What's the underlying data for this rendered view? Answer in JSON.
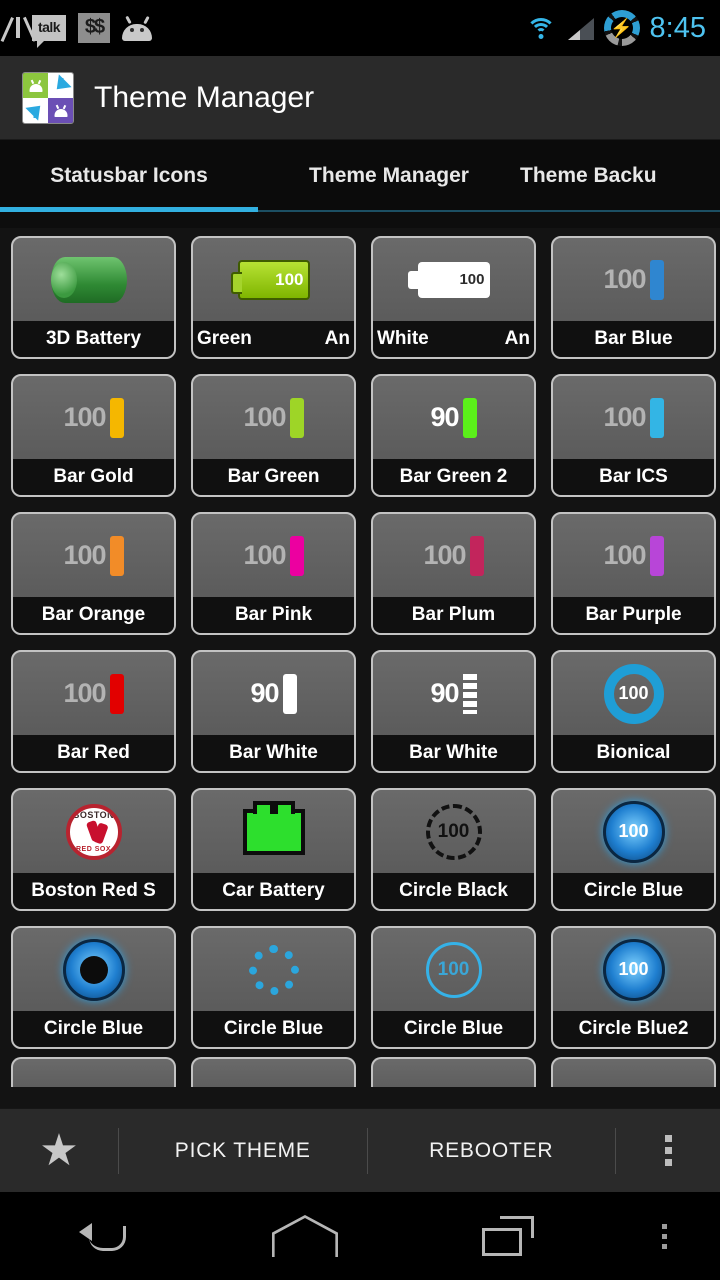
{
  "statusbar": {
    "icons_left": [
      "gmail-icon",
      "talk-icon",
      "currency-icon",
      "android-icon"
    ],
    "icons_right": [
      "wifi-icon",
      "signal-icon",
      "battery-icon"
    ],
    "clock": "8:45",
    "clock_color": "#4ec3f0"
  },
  "actionbar": {
    "app_icon": "theme-manager-app-icon",
    "title": "Theme Manager"
  },
  "tabs": [
    {
      "label": "Statusbar Icons",
      "active": true
    },
    {
      "label": "Theme Manager",
      "active": false
    },
    {
      "label": "Theme Backu",
      "active": false
    }
  ],
  "accent_color": "#32b0e0",
  "grid": {
    "items": [
      {
        "label": "3D Battery",
        "icon": "battery-3d-green-icon",
        "value": ""
      },
      {
        "label": "Green",
        "label2": "An",
        "icon": "battery-green-android-icon",
        "value": "100"
      },
      {
        "label": "White",
        "label2": "An",
        "icon": "battery-white-android-icon",
        "value": "100"
      },
      {
        "label": "Bar Blue",
        "icon": "battery-bar-icon",
        "value": "100",
        "color": "#2f86d0"
      },
      {
        "label": "Bar Gold",
        "icon": "battery-bar-icon",
        "value": "100",
        "color": "#f5b700"
      },
      {
        "label": "Bar Green",
        "icon": "battery-bar-icon",
        "value": "100",
        "color": "#9ed527"
      },
      {
        "label": "Bar Green 2",
        "icon": "battery-bar-icon",
        "value": "90",
        "color": "#5bf01a"
      },
      {
        "label": "Bar ICS",
        "icon": "battery-bar-icon",
        "value": "100",
        "color": "#33b5e5"
      },
      {
        "label": "Bar Orange",
        "icon": "battery-bar-icon",
        "value": "100",
        "color": "#f28c28"
      },
      {
        "label": "Bar Pink",
        "icon": "battery-bar-icon",
        "value": "100",
        "color": "#ec00a0"
      },
      {
        "label": "Bar Plum",
        "icon": "battery-bar-icon",
        "value": "100",
        "color": "#c2255c"
      },
      {
        "label": "Bar Purple",
        "icon": "battery-bar-icon",
        "value": "100",
        "color": "#b845d8"
      },
      {
        "label": "Bar Red",
        "icon": "battery-bar-icon",
        "value": "100",
        "color": "#e20000"
      },
      {
        "label": "Bar White",
        "icon": "battery-bar-icon",
        "value": "90",
        "color": "#ffffff"
      },
      {
        "label": "Bar White",
        "icon": "battery-bar-segmented-icon",
        "value": "90",
        "color": "#ffffff"
      },
      {
        "label": "Bionical",
        "icon": "battery-ring-bionical-icon",
        "value": "100",
        "color": "#1f9ed6"
      },
      {
        "label": "Boston Red S",
        "icon": "boston-red-sox-logo-icon",
        "value": ""
      },
      {
        "label": "Car Battery",
        "icon": "car-battery-icon",
        "value": ""
      },
      {
        "label": "Circle Black",
        "icon": "battery-circle-black-icon",
        "value": "100"
      },
      {
        "label": "Circle Blue",
        "icon": "battery-circle-blue-glow-icon",
        "value": "100"
      },
      {
        "label": "Circle Blue",
        "icon": "battery-circle-blue-hollow-icon",
        "value": ""
      },
      {
        "label": "Circle Blue",
        "icon": "battery-circle-blue-dotted-icon",
        "value": ""
      },
      {
        "label": "Circle Blue",
        "icon": "battery-circle-blue-thin-icon",
        "value": "100"
      },
      {
        "label": "Circle Blue2",
        "icon": "battery-circle-blue2-glow-icon",
        "value": "100"
      }
    ]
  },
  "bottombar": {
    "favorite_icon": "star-icon",
    "pick_theme": "PICK THEME",
    "rebooter": "REBOOTER",
    "overflow_icon": "overflow-menu-icon"
  },
  "navbar": {
    "back": "back-icon",
    "home": "home-icon",
    "recents": "recents-icon",
    "menu": "menu-icon"
  }
}
